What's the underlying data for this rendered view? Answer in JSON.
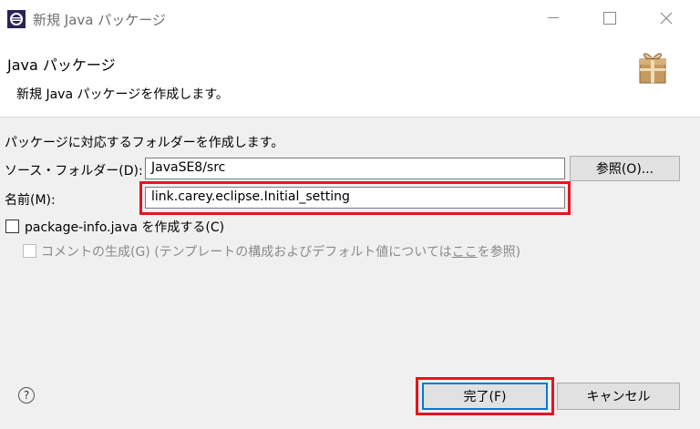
{
  "window": {
    "title": "新規 Java パッケージ"
  },
  "header": {
    "title": "Java パッケージ",
    "description": "新規 Java パッケージを作成します。"
  },
  "form": {
    "intro": "パッケージに対応するフォルダーを作成します。",
    "source_folder_label": "ソース・フォルダー(D):",
    "source_folder_value": "JavaSE8/src",
    "browse_label": "参照(O)...",
    "name_label": "名前(M):",
    "name_value": "link.carey.eclipse.Initial_setting",
    "package_info_label": "package-info.java を作成する(C)",
    "package_info_checked": false,
    "comment_label_pre": "コメントの生成(G) (テンプレートの構成およびデフォルト値については",
    "comment_link": "ここ",
    "comment_label_post": "を参照)",
    "comment_checked": false,
    "comment_enabled": false
  },
  "footer": {
    "help_icon": "question-circle-icon",
    "finish_label": "完了(F)",
    "cancel_label": "キャンセル"
  },
  "colors": {
    "highlight": "#e8131f",
    "default_button_border": "#0078d7",
    "content_bg": "#f0f0f0"
  }
}
